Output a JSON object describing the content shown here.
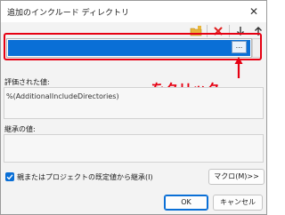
{
  "window": {
    "title": "追加のインクルード ディレクトリ",
    "close_glyph": "✕"
  },
  "toolbar": {
    "buttons": [
      {
        "name": "new-folder-icon",
        "color": "#d9a520"
      },
      {
        "name": "delete-icon",
        "color": "#e02020"
      },
      {
        "name": "move-down-icon",
        "color": "#333333"
      },
      {
        "name": "move-up-icon",
        "color": "#333333"
      }
    ]
  },
  "editor": {
    "row_value": "",
    "ellipsis_label": "..."
  },
  "annotation": {
    "text": "…をクリック",
    "color": "#e60012"
  },
  "evaluated": {
    "label": "評価された値:",
    "value": "%(AdditionalIncludeDirectories)"
  },
  "inherited": {
    "label": "継承の値:",
    "value": ""
  },
  "inherit_checkbox": {
    "label": "親またはプロジェクトの既定値から継承(I)",
    "checked": true
  },
  "buttons": {
    "macro": "マクロ(M)>>",
    "ok": "OK",
    "cancel": "キャンセル"
  },
  "colors": {
    "accent": "#0a6fd6",
    "highlight_box": "#e60012"
  }
}
